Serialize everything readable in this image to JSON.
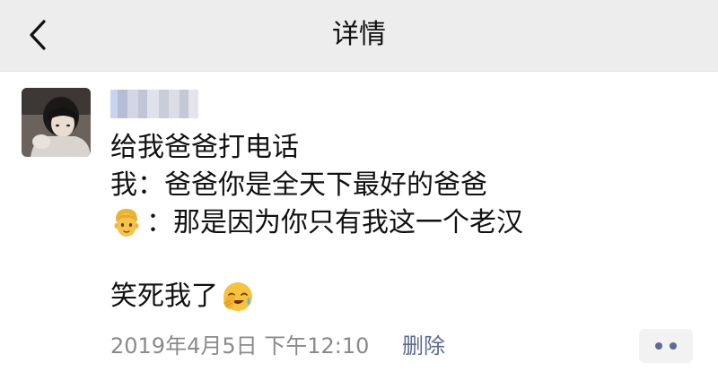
{
  "header": {
    "title": "详情",
    "back_icon": "chevron-left-icon"
  },
  "post": {
    "avatar_icon": "user-avatar-photo",
    "lines": [
      "给我爸爸打电话",
      "我：爸爸你是全天下最好的爸爸",
      "：那是因为你只有我这一个老汉",
      "",
      "笑死我了"
    ],
    "line3_prefix_emoji": "man-face-emoji",
    "line5_suffix_emoji": "face-holding-back-tears-emoji",
    "timestamp": "2019年4月5日 下午12:10",
    "delete_label": "删除",
    "more_icon": "two-dots-icon"
  },
  "colors": {
    "header_bg": "#ededed",
    "link": "#5b6b92",
    "meta": "#8a8a8a"
  }
}
